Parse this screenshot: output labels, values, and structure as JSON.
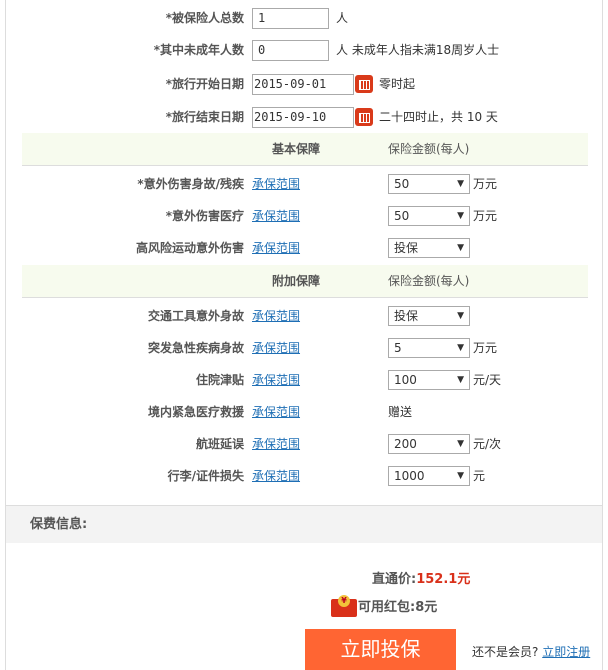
{
  "basic_fields": [
    {
      "label": "*被保险人总数",
      "value": "1",
      "note": "人"
    },
    {
      "label": "*其中未成年人数",
      "value": "0",
      "note": "人 未成年人指未满18周岁人士"
    },
    {
      "label": "*旅行开始日期",
      "value": "2015-09-01",
      "note": "零时起"
    },
    {
      "label": "*旅行结束日期",
      "value": "2015-09-10",
      "note": "二十四时止，共 10 天"
    }
  ],
  "basic_section": {
    "title": "基本保障",
    "amount_header": "保险金额(每人)"
  },
  "basic_items": [
    {
      "label": "*意外伤害身故/残疾",
      "link": "承保范围",
      "value": "50",
      "unit": "万元"
    },
    {
      "label": "*意外伤害医疗",
      "link": "承保范围",
      "value": "50",
      "unit": "万元"
    },
    {
      "label": "高风险运动意外伤害",
      "link": "承保范围",
      "value": "投保",
      "unit": ""
    }
  ],
  "extra_section": {
    "title": "附加保障",
    "amount_header": "保险金额(每人)"
  },
  "extra_items": [
    {
      "label": "交通工具意外身故",
      "link": "承保范围",
      "value": "投保",
      "unit": ""
    },
    {
      "label": "突发急性疾病身故",
      "link": "承保范围",
      "value": "5",
      "unit": "万元"
    },
    {
      "label": "住院津贴",
      "link": "承保范围",
      "value": "100",
      "unit": "元/天"
    },
    {
      "label": "境内紧急医疗救援",
      "link": "承保范围",
      "gift": "赠送"
    },
    {
      "label": "航班延误",
      "link": "承保范围",
      "value": "200",
      "unit": "元/次"
    },
    {
      "label": "行李/证件损失",
      "link": "承保范围",
      "value": "1000",
      "unit": "元"
    }
  ],
  "fee": {
    "title": "保费信息:",
    "price_label": "直通价:",
    "price": "152.1元",
    "packet_label": "可用红包:",
    "packet": "8元",
    "submit": "立即投保",
    "member_q": "还不是会员?",
    "register": "立即注册"
  }
}
